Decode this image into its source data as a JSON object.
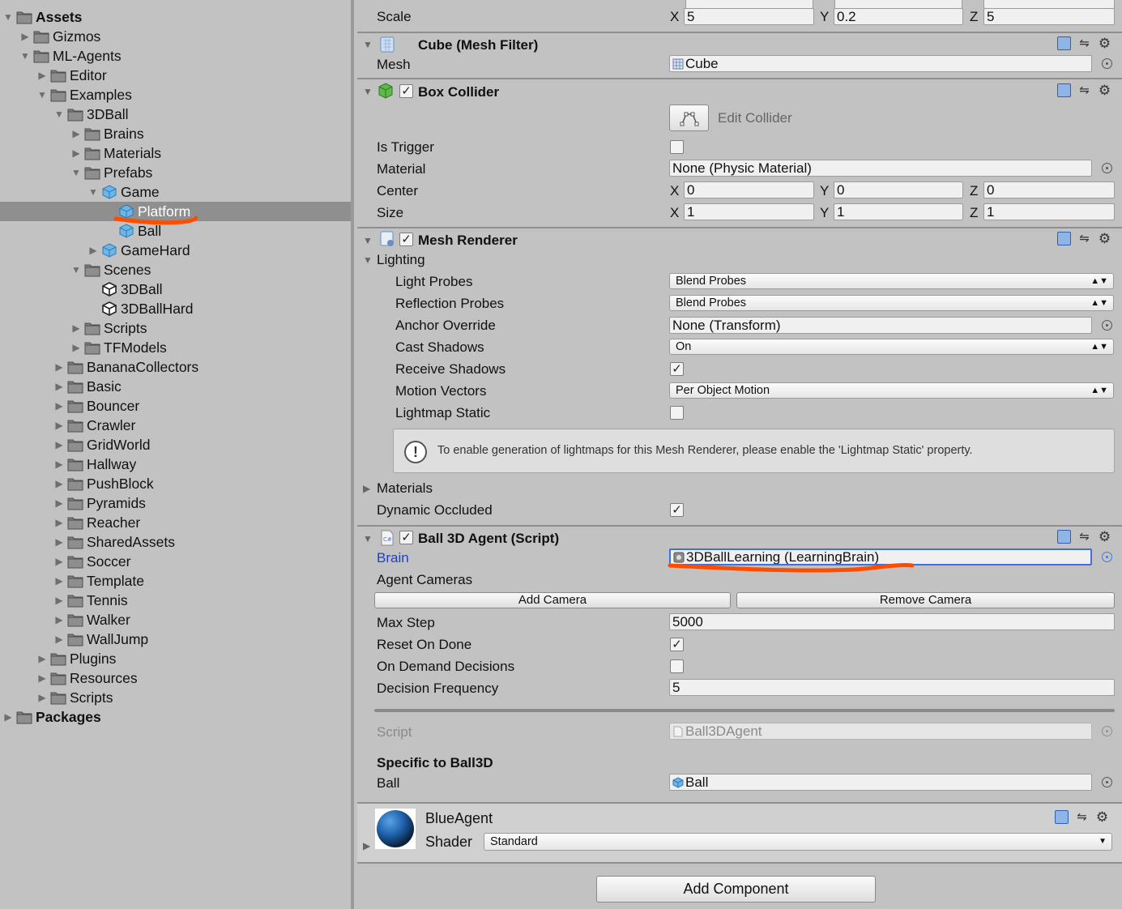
{
  "project": {
    "items": [
      {
        "label": "Assets",
        "depth": 0,
        "arrow": "down",
        "icon": "folder-icon",
        "bold": true
      },
      {
        "label": "Gizmos",
        "depth": 1,
        "arrow": "right",
        "icon": "folder-icon"
      },
      {
        "label": "ML-Agents",
        "depth": 1,
        "arrow": "down",
        "icon": "folder-icon"
      },
      {
        "label": "Editor",
        "depth": 2,
        "arrow": "right",
        "icon": "folder-icon"
      },
      {
        "label": "Examples",
        "depth": 2,
        "arrow": "down",
        "icon": "folder-icon"
      },
      {
        "label": "3DBall",
        "depth": 3,
        "arrow": "down",
        "icon": "folder-icon"
      },
      {
        "label": "Brains",
        "depth": 4,
        "arrow": "right",
        "icon": "folder-icon"
      },
      {
        "label": "Materials",
        "depth": 4,
        "arrow": "right",
        "icon": "folder-icon"
      },
      {
        "label": "Prefabs",
        "depth": 4,
        "arrow": "down",
        "icon": "folder-icon"
      },
      {
        "label": "Game",
        "depth": 5,
        "arrow": "down",
        "icon": "prefab-icon"
      },
      {
        "label": "Platform",
        "depth": 6,
        "arrow": "none",
        "icon": "prefab-icon",
        "selected": true
      },
      {
        "label": "Ball",
        "depth": 6,
        "arrow": "none",
        "icon": "prefab-icon"
      },
      {
        "label": "GameHard",
        "depth": 5,
        "arrow": "right",
        "icon": "prefab-icon"
      },
      {
        "label": "Scenes",
        "depth": 4,
        "arrow": "down",
        "icon": "folder-icon"
      },
      {
        "label": "3DBall",
        "depth": 5,
        "arrow": "none",
        "icon": "unity-scene-icon"
      },
      {
        "label": "3DBallHard",
        "depth": 5,
        "arrow": "none",
        "icon": "unity-scene-icon"
      },
      {
        "label": "Scripts",
        "depth": 4,
        "arrow": "right",
        "icon": "folder-icon"
      },
      {
        "label": "TFModels",
        "depth": 4,
        "arrow": "right",
        "icon": "folder-icon"
      },
      {
        "label": "BananaCollectors",
        "depth": 3,
        "arrow": "right",
        "icon": "folder-icon"
      },
      {
        "label": "Basic",
        "depth": 3,
        "arrow": "right",
        "icon": "folder-icon"
      },
      {
        "label": "Bouncer",
        "depth": 3,
        "arrow": "right",
        "icon": "folder-icon"
      },
      {
        "label": "Crawler",
        "depth": 3,
        "arrow": "right",
        "icon": "folder-icon"
      },
      {
        "label": "GridWorld",
        "depth": 3,
        "arrow": "right",
        "icon": "folder-icon"
      },
      {
        "label": "Hallway",
        "depth": 3,
        "arrow": "right",
        "icon": "folder-icon"
      },
      {
        "label": "PushBlock",
        "depth": 3,
        "arrow": "right",
        "icon": "folder-icon"
      },
      {
        "label": "Pyramids",
        "depth": 3,
        "arrow": "right",
        "icon": "folder-icon"
      },
      {
        "label": "Reacher",
        "depth": 3,
        "arrow": "right",
        "icon": "folder-icon"
      },
      {
        "label": "SharedAssets",
        "depth": 3,
        "arrow": "right",
        "icon": "folder-icon"
      },
      {
        "label": "Soccer",
        "depth": 3,
        "arrow": "right",
        "icon": "folder-icon"
      },
      {
        "label": "Template",
        "depth": 3,
        "arrow": "right",
        "icon": "folder-icon"
      },
      {
        "label": "Tennis",
        "depth": 3,
        "arrow": "right",
        "icon": "folder-icon"
      },
      {
        "label": "Walker",
        "depth": 3,
        "arrow": "right",
        "icon": "folder-icon"
      },
      {
        "label": "WallJump",
        "depth": 3,
        "arrow": "right",
        "icon": "folder-icon"
      },
      {
        "label": "Plugins",
        "depth": 2,
        "arrow": "right",
        "icon": "folder-icon"
      },
      {
        "label": "Resources",
        "depth": 2,
        "arrow": "right",
        "icon": "folder-icon"
      },
      {
        "label": "Scripts",
        "depth": 2,
        "arrow": "right",
        "icon": "folder-icon"
      },
      {
        "label": "Packages",
        "depth": 0,
        "arrow": "right",
        "icon": "folder-icon",
        "bold": true
      }
    ]
  },
  "transform": {
    "scale_label": "Scale",
    "x_label": "X",
    "y_label": "Y",
    "z_label": "Z",
    "scale": {
      "x": "5",
      "y": "0.2",
      "z": "5"
    }
  },
  "mesh_filter": {
    "title": "Cube (Mesh Filter)",
    "mesh_label": "Mesh",
    "mesh_value": "Cube"
  },
  "box_collider": {
    "title": "Box Collider",
    "enabled": true,
    "edit_collider": "Edit Collider",
    "is_trigger_label": "Is Trigger",
    "is_trigger": false,
    "material_label": "Material",
    "material_value": "None (Physic Material)",
    "center_label": "Center",
    "center": {
      "x": "0",
      "y": "0",
      "z": "0"
    },
    "size_label": "Size",
    "size": {
      "x": "1",
      "y": "1",
      "z": "1"
    }
  },
  "mesh_renderer": {
    "title": "Mesh Renderer",
    "enabled": true,
    "lighting_label": "Lighting",
    "light_probes_label": "Light Probes",
    "light_probes_value": "Blend Probes",
    "reflection_probes_label": "Reflection Probes",
    "reflection_probes_value": "Blend Probes",
    "anchor_override_label": "Anchor Override",
    "anchor_override_value": "None (Transform)",
    "cast_shadows_label": "Cast Shadows",
    "cast_shadows_value": "On",
    "receive_shadows_label": "Receive Shadows",
    "receive_shadows": true,
    "motion_vectors_label": "Motion Vectors",
    "motion_vectors_value": "Per Object Motion",
    "lightmap_static_label": "Lightmap Static",
    "lightmap_static": false,
    "help_text": "To enable generation of lightmaps for this Mesh Renderer, please enable the 'Lightmap Static' property.",
    "materials_label": "Materials",
    "dynamic_occluded_label": "Dynamic Occluded",
    "dynamic_occluded": true
  },
  "agent": {
    "title": "Ball 3D Agent (Script)",
    "enabled": true,
    "brain_label": "Brain",
    "brain_value": "3DBallLearning (LearningBrain)",
    "agent_cameras_label": "Agent Cameras",
    "add_camera": "Add Camera",
    "remove_camera": "Remove Camera",
    "max_step_label": "Max Step",
    "max_step_value": "5000",
    "reset_on_done_label": "Reset On Done",
    "reset_on_done": true,
    "on_demand_label": "On Demand Decisions",
    "on_demand": false,
    "decision_frequency_label": "Decision Frequency",
    "decision_frequency_value": "5",
    "script_label": "Script",
    "script_value": "Ball3DAgent",
    "specific_label": "Specific to Ball3D",
    "ball_label": "Ball",
    "ball_value": "Ball"
  },
  "material": {
    "name": "BlueAgent",
    "shader_label": "Shader",
    "shader_value": "Standard"
  },
  "add_component": "Add Component",
  "colors": {
    "annotation": "#ff4d00",
    "selection": "#3f6fe0",
    "panel": "#c2c2c2"
  }
}
